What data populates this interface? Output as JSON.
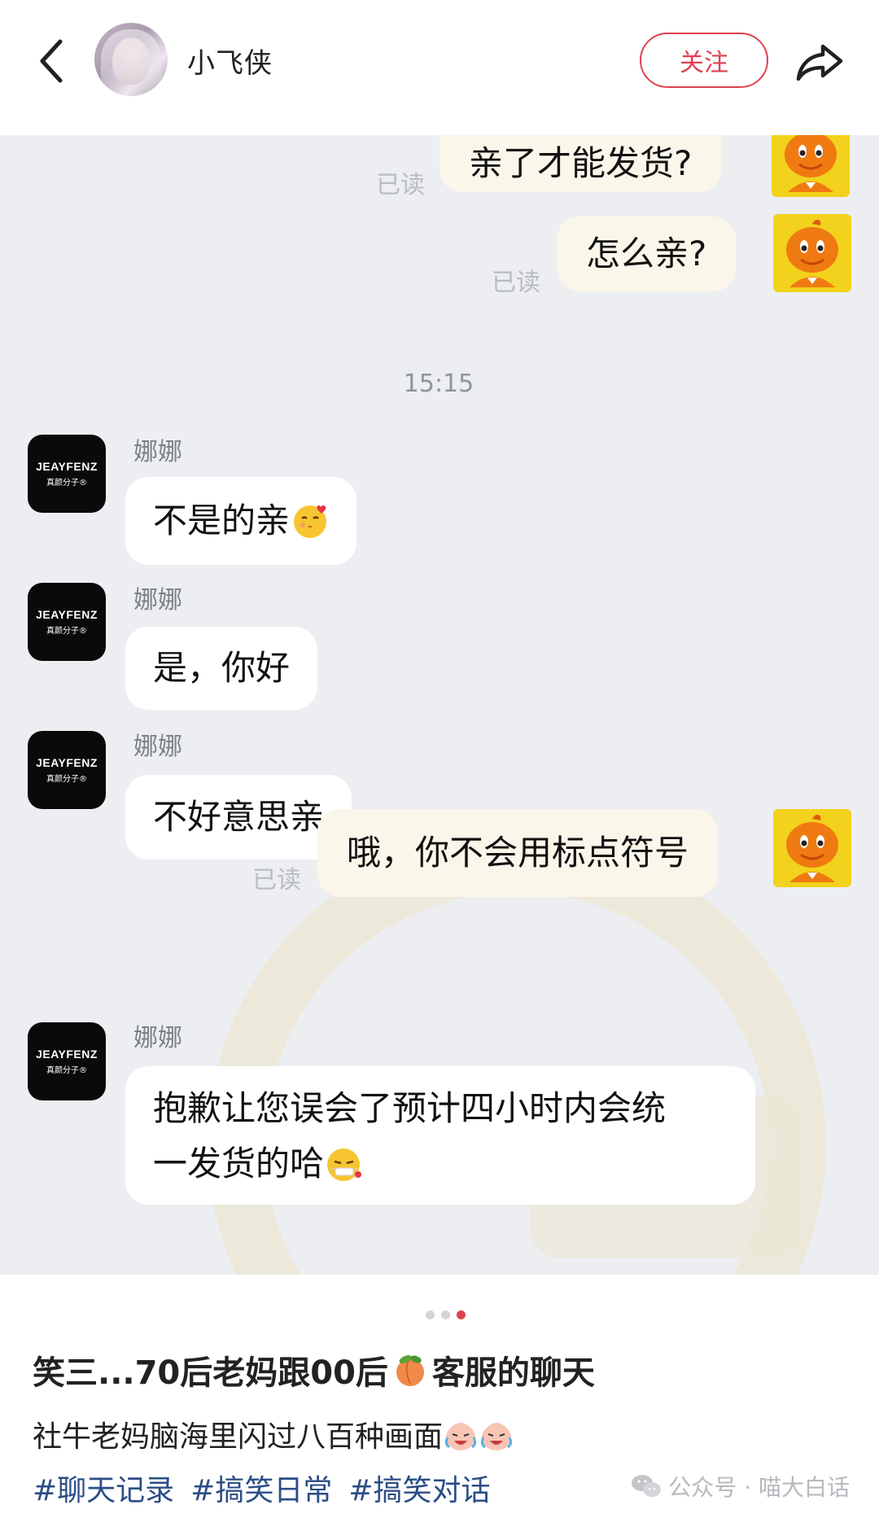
{
  "header": {
    "back_icon": "chevron-left-icon",
    "name": "小飞侠",
    "follow_label": "关注",
    "share_icon": "share-arrow-icon",
    "accent": "#e0404f"
  },
  "chat": {
    "read_label": "已读",
    "timestamp": "15:15",
    "store_brand": "JEAYFENZ",
    "store_brand_sub": "真颜分子®",
    "sender_name": "娜娜",
    "messages": [
      {
        "from": "me",
        "text": "亲了才能发货?"
      },
      {
        "from": "me",
        "text": "怎么亲?"
      },
      {
        "from": "store",
        "text": "不是的亲",
        "emoji": "kissing-face-emoji"
      },
      {
        "from": "store",
        "text": "是，你好"
      },
      {
        "from": "store",
        "text": "不好意思亲"
      },
      {
        "from": "me",
        "text": "哦，你不会用标点符号"
      },
      {
        "from": "store",
        "text_line1": "抱歉让您误会了预计四小时内会统",
        "text_line2": "一发货的哈",
        "emoji": "sweating-face-emoji"
      }
    ]
  },
  "post": {
    "page_indicator": {
      "total": 3,
      "active": 3
    },
    "title": "笑三...70后老妈跟00后",
    "title_emoji": "peach-emoji",
    "title_suffix": "客服的聊天",
    "description": "社牛老妈脑海里闪过八百种画面",
    "description_emoji": "crying-laughing-face-emoji",
    "tags": [
      "#聊天记录",
      "#搞笑日常",
      "#搞笑对话"
    ],
    "watermark": {
      "icon": "wechat-icon",
      "text": "公众号 · 喵大白话"
    }
  }
}
